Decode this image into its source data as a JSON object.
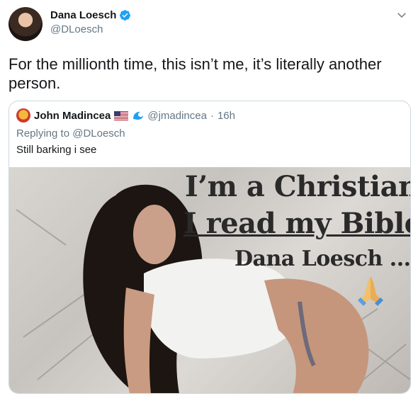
{
  "author": {
    "name": "Dana Loesch",
    "handle": "@DLoesch"
  },
  "tweet": {
    "text": "For the millionth time, this isn’t me, it’s literally another person."
  },
  "quoted": {
    "name": "John Madincea",
    "handle": "@jmadincea",
    "separator": "·",
    "time": "16h",
    "reply_prefix": "Replying to",
    "reply_to": "@DLoesch",
    "text": "Still barking i see",
    "image": {
      "line1": "I’m a Christian",
      "line2": "I read my Bible",
      "line3": "Dana Loesch ..."
    }
  },
  "colors": {
    "verified": "#1da1f2",
    "text": "#14171a",
    "secondary": "#657786",
    "border": "#ccd6dd"
  },
  "icons": [
    "verified-badge-icon",
    "chevron-down-icon",
    "us-flag-icon",
    "wave-icon",
    "praying-hands-icon"
  ]
}
